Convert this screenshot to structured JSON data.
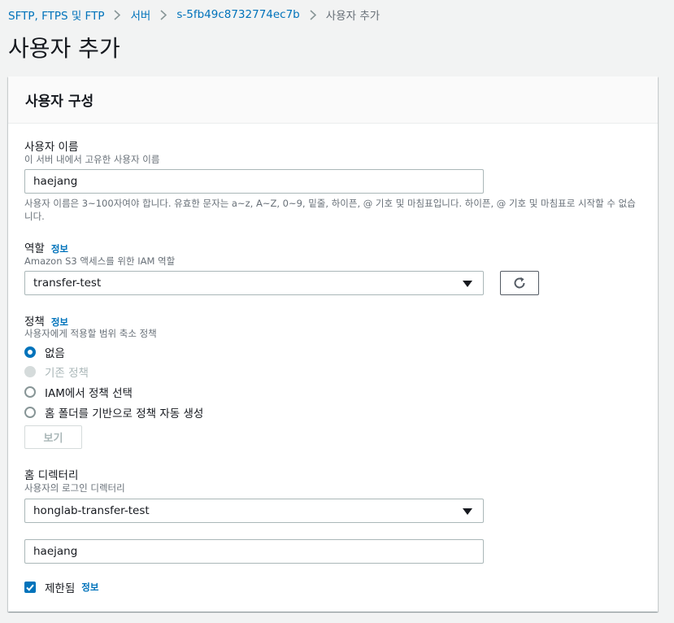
{
  "breadcrumb": {
    "items": [
      "SFTP, FTPS 및 FTP",
      "서버",
      "s-5fb49c8732774ec7b"
    ],
    "current": "사용자 추가"
  },
  "page_title": "사용자 추가",
  "panel": {
    "title": "사용자 구성"
  },
  "username": {
    "label": "사용자 이름",
    "description": "이 서버 내에서 고유한 사용자 이름",
    "value": "haejang",
    "help": "사용자 이름은 3~100자여야 합니다. 유효한 문자는 a~z, A~Z, 0~9, 밑줄, 하이픈, @ 기호 및 마침표입니다. 하이픈, @ 기호 및 마침표로 시작할 수 없습니다."
  },
  "role": {
    "label": "역할",
    "info": "정보",
    "description": "Amazon S3 액세스를 위한 IAM 역할",
    "selected": "transfer-test",
    "refresh_icon": "refresh-icon"
  },
  "policy": {
    "label": "정책",
    "info": "정보",
    "description": "사용자에게 적용할 범위 축소 정책",
    "options": [
      {
        "label": "없음",
        "state": "checked"
      },
      {
        "label": "기존 정책",
        "state": "disabled"
      },
      {
        "label": "IAM에서 정책 선택",
        "state": "unchecked"
      },
      {
        "label": "홈 폴더를 기반으로 정책 자동 생성",
        "state": "unchecked"
      }
    ],
    "view_button": "보기"
  },
  "home_directory": {
    "label": "홈 디렉터리",
    "description": "사용자의 로그인 디렉터리",
    "bucket_selected": "honglab-transfer-test",
    "folder_value": "haejang"
  },
  "restricted": {
    "label": "제한됨",
    "info": "정보",
    "checked": true
  },
  "colors": {
    "link": "#0073bb",
    "background": "#f2f3f3",
    "text": "#16191f",
    "muted": "#687078"
  }
}
